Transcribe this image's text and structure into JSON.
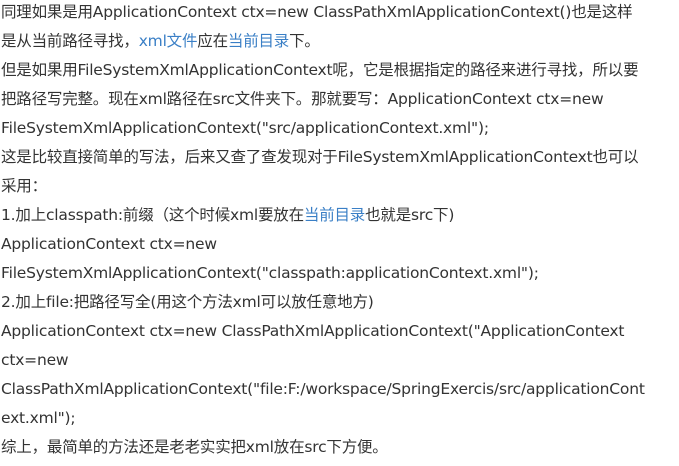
{
  "colors": {
    "text": "#333333",
    "link": "#3a7fc6",
    "background": "#ffffff"
  },
  "lines": [
    {
      "text": "同理如果是用ApplicationContext ctx=new  ClassPathXmlApplicationContext()也是这样"
    },
    {
      "pre": "是从当前路径寻找，",
      "link1": "xml文件",
      "mid": "应在",
      "link2": "当前目录",
      "post": "下。"
    },
    {
      "text": "但是如果用FileSystemXmlApplicationContext呢，它是根据指定的路径来进行寻找，所以要"
    },
    {
      "text": "把路径写完整。现在xml路径在src文件夹下。那就要写：ApplicationContext ctx=new"
    },
    {
      "text": "FileSystemXmlApplicationContext(\"src/applicationContext.xml\");"
    },
    {
      "text": "这是比较直接简单的写法，后来又查了查发现对于FileSystemXmlApplicationContext也可以"
    },
    {
      "text": "采用："
    },
    {
      "pre": "1.加上classpath:前缀（这个时候xml要放在",
      "link1": "当前目录",
      "post": "也就是src下)"
    },
    {
      "text": "ApplicationContext ctx=new"
    },
    {
      "text": "FileSystemXmlApplicationContext(\"classpath:applicationContext.xml\");"
    },
    {
      "text": "2.加上file:把路径写全(用这个方法xml可以放任意地方)"
    },
    {
      "text": "ApplicationContext ctx=new  ClassPathXmlApplicationContext(\"ApplicationContext"
    },
    {
      "text": "ctx=new"
    },
    {
      "text": "ClassPathXmlApplicationContext(\"file:F:/workspace/SpringExercis/src/applicationCont"
    },
    {
      "text": "ext.xml\");"
    },
    {
      "text": "综上，最简单的方法还是老老实实把xml放在src下方便。"
    }
  ]
}
